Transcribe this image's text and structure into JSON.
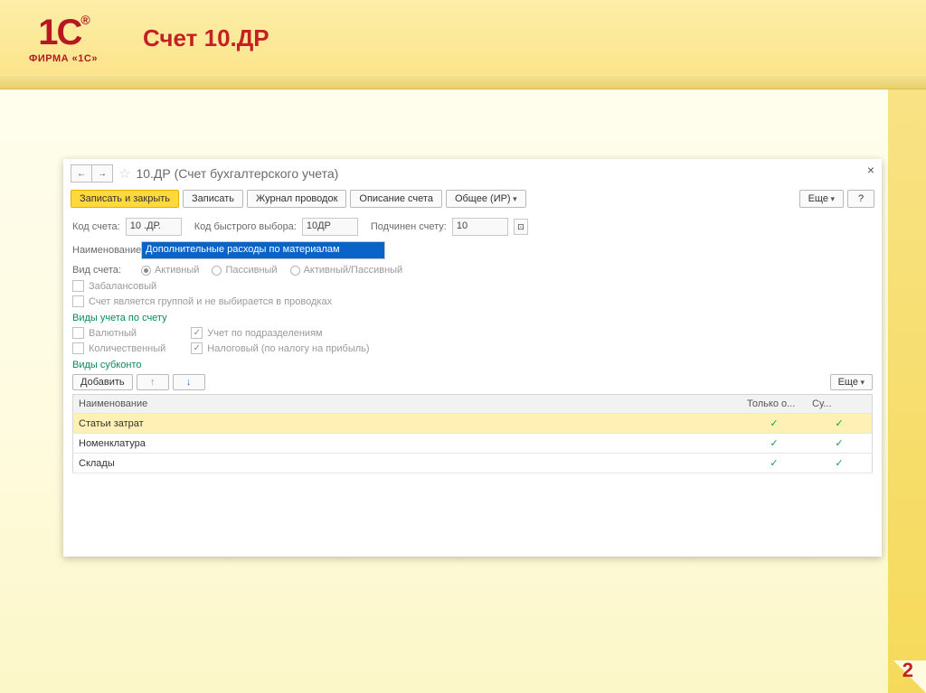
{
  "slide": {
    "brand_top": "1C",
    "brand_reg": "®",
    "brand_sub": "ФИРМА «1С»",
    "title": "Счет 10.ДР",
    "page_number": "2"
  },
  "window": {
    "title": "10.ДР (Счет бухгалтерского учета)",
    "nav_back": "←",
    "nav_fwd": "→",
    "close": "×",
    "star": "☆"
  },
  "toolbar": {
    "save_close": "Записать и закрыть",
    "save": "Записать",
    "journal": "Журнал проводок",
    "description": "Описание счета",
    "common_ir": "Общее (ИР)",
    "more": "Еще",
    "help": "?"
  },
  "form": {
    "code_label": "Код счета:",
    "code_value": "10 .ДР.",
    "fastcode_label": "Код быстрого выбора:",
    "fastcode_value": "10ДР",
    "parent_label": "Подчинен счету:",
    "parent_value": "10",
    "name_label": "Наименование:",
    "name_value": "Дополнительные расходы по материалам",
    "kind_label": "Вид счета:",
    "kind_options": [
      "Активный",
      "Пассивный",
      "Активный/Пассивный"
    ],
    "chk_offbalance": "Забалансовый",
    "chk_isgroup": "Счет является группой и не выбирается в проводках",
    "section_account_types": "Виды учета по счету",
    "chk_currency": "Валютный",
    "chk_by_division": "Учет по подразделениям",
    "chk_quantity": "Количественный",
    "chk_tax": "Налоговый (по налогу на прибыль)",
    "section_subkonto": "Виды субконто"
  },
  "subkonto_toolbar": {
    "add": "Добавить",
    "up": "↑",
    "down": "↓",
    "more": "Еще"
  },
  "table": {
    "columns": [
      "Наименование",
      "Только о...",
      "Су..."
    ],
    "rows": [
      {
        "name": "Статьи затрат",
        "only": true,
        "sum": true,
        "highlight": true
      },
      {
        "name": "Номенклатура",
        "only": true,
        "sum": true,
        "highlight": false
      },
      {
        "name": "Склады",
        "only": true,
        "sum": true,
        "highlight": false
      }
    ]
  }
}
